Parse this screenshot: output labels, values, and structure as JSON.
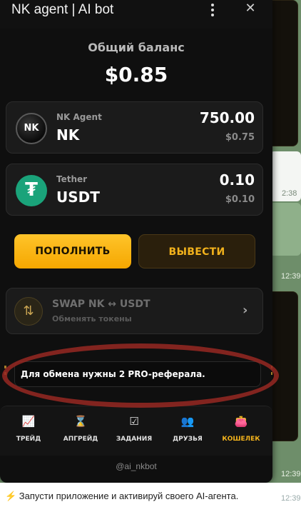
{
  "window": {
    "title": "NK agent | AI bot",
    "close_glyph": "✕"
  },
  "balance": {
    "label": "Общий баланс",
    "value": "$0.85"
  },
  "tokens": [
    {
      "subtitle": "NK Agent",
      "symbol": "NK",
      "amount": "750.00",
      "usd": "$0.75",
      "logo_text": "NK",
      "icon": "nk-agent-logo-icon"
    },
    {
      "subtitle": "Tether",
      "symbol": "USDT",
      "amount": "0.10",
      "usd": "$0.10",
      "logo_text": "₮",
      "icon": "tether-logo-icon"
    }
  ],
  "actions": {
    "deposit": "ПОПОЛНИТЬ",
    "withdraw": "ВЫВЕСТИ"
  },
  "swap": {
    "title": "SWAP NK ↔ USDT",
    "subtitle": "Обменять токены",
    "icon": "swap-arrows-icon"
  },
  "notice": "Для обмена нужны 2 PRO-реферала.",
  "nav": [
    {
      "label": "ТРЕЙД",
      "icon": "chart-line-icon",
      "glyph": "📈"
    },
    {
      "label": "АПГРЕЙД",
      "icon": "hourglass-icon",
      "glyph": "⌛"
    },
    {
      "label": "ЗАДАНИЯ",
      "icon": "checkbox-icon",
      "glyph": "☑"
    },
    {
      "label": "ДРУЗЬЯ",
      "icon": "users-icon",
      "glyph": "👥"
    },
    {
      "label": "КОШЕЛЕК",
      "icon": "wallet-icon",
      "glyph": "👛",
      "active": true
    }
  ],
  "bot_handle": "@ai_nkbot",
  "chat": {
    "times": [
      "2:38",
      "12:39",
      "12:39"
    ],
    "bottom_message": "⚡ Запусти приложение и активируй своего AI-агента.",
    "bottom_time": "12:39"
  },
  "colors": {
    "accent": "#f5a700",
    "background": "#0f0f0f",
    "card": "#1b1b1b",
    "tether": "#1aa37a"
  }
}
